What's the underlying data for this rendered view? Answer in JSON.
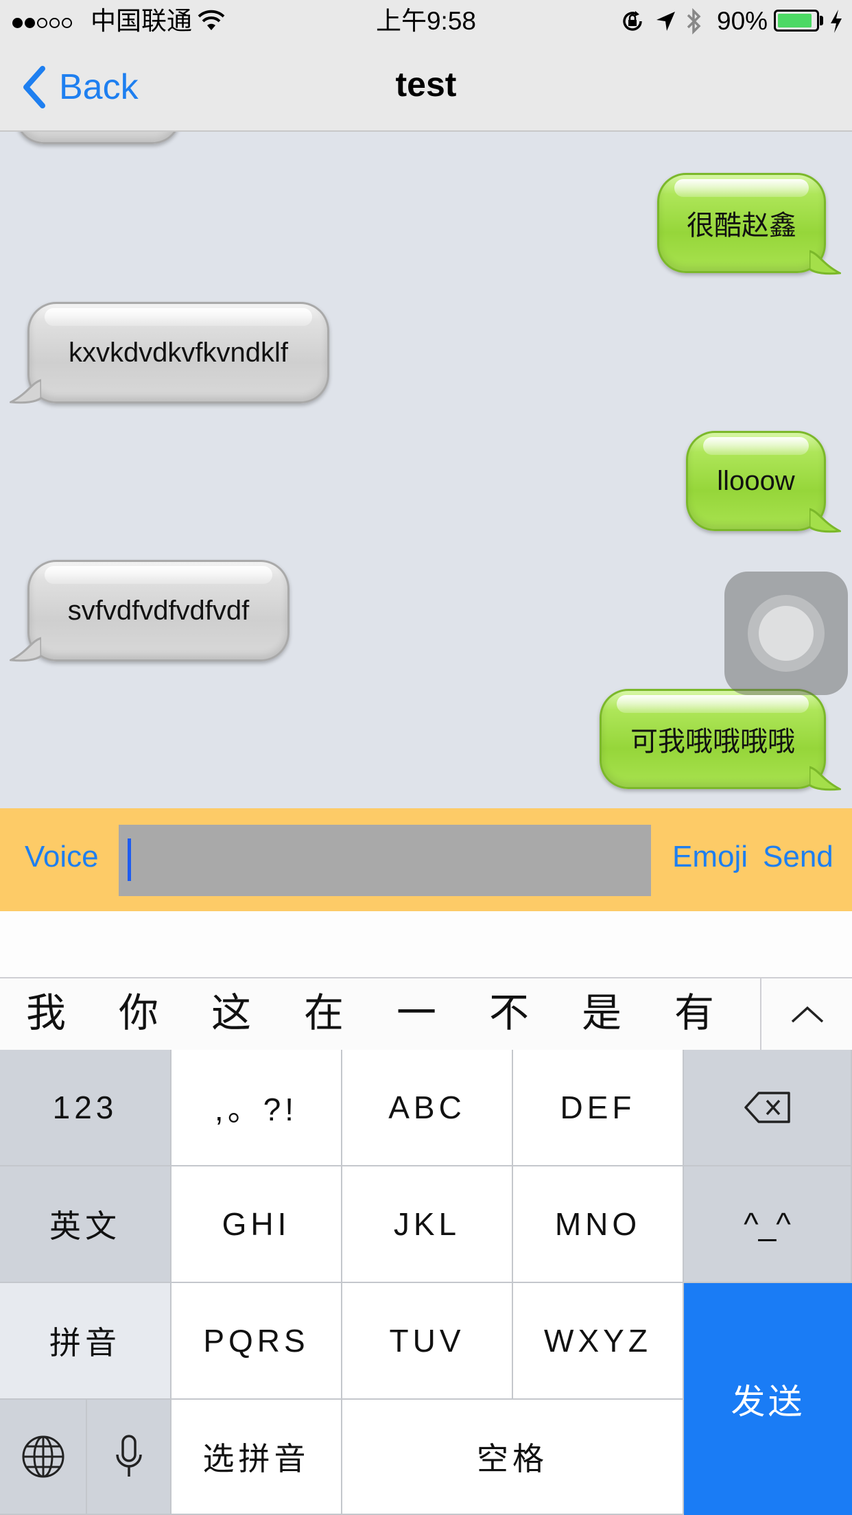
{
  "status_bar": {
    "carrier": "中国联通",
    "time": "上午9:58",
    "battery_percent": "90%",
    "battery_level": 0.9,
    "signal_full_dots": 2,
    "signal_total_dots": 5,
    "icons": [
      "wifi-icon",
      "rotation-lock-icon",
      "location-arrow-icon",
      "bluetooth-icon",
      "battery-icon",
      "charging-bolt-icon"
    ],
    "battery_color": "#4cd964"
  },
  "nav": {
    "back_label": "Back",
    "title": "test",
    "accent": "#1e7ff0"
  },
  "chat": {
    "messages": [
      {
        "side": "in",
        "text": ""
      },
      {
        "side": "out",
        "text": "很酷赵鑫"
      },
      {
        "side": "in",
        "text": "kxvkdvdkvfkvndklf"
      },
      {
        "side": "out",
        "text": "llooow"
      },
      {
        "side": "in",
        "text": "svfvdfvdfvdfvdf"
      },
      {
        "side": "out",
        "text": "可我哦哦哦哦"
      }
    ],
    "incoming_color": "#d6d6d6",
    "outgoing_color": "#9fdc45"
  },
  "input_bar": {
    "voice_label": "Voice",
    "input_value": "",
    "emoji_label": "Emoji",
    "send_label": "Send",
    "background": "#fdcb67"
  },
  "keyboard": {
    "candidates": [
      "我",
      "你",
      "这",
      "在",
      "一",
      "不",
      "是",
      "有"
    ],
    "rows": {
      "row1": {
        "left": "123",
        "k1": ",。?!",
        "k2": "ABC",
        "k3": "DEF"
      },
      "row2": {
        "left": "英文",
        "k1": "GHI",
        "k2": "JKL",
        "k3": "MNO",
        "right": "^_^"
      },
      "row3": {
        "left": "拼音",
        "k1": "PQRS",
        "k2": "TUV",
        "k3": "WXYZ"
      },
      "row4": {
        "select": "选拼音",
        "space": "空格"
      }
    },
    "send_key": "发送",
    "send_color": "#1a7cf5"
  }
}
